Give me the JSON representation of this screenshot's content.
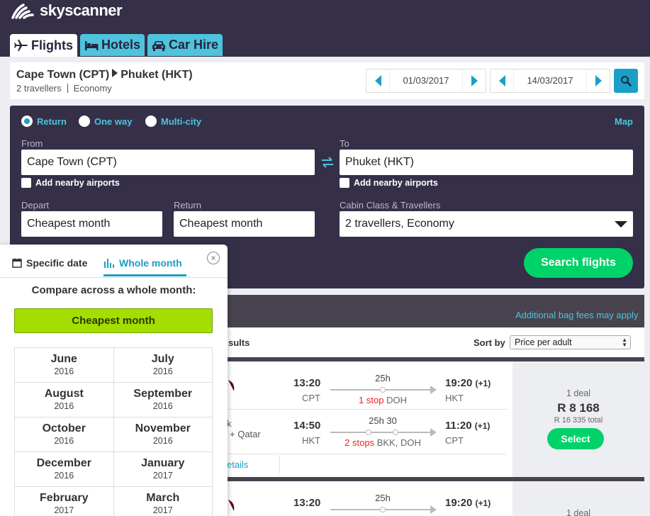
{
  "brand": {
    "name": "skyscanner"
  },
  "nav_tabs": [
    {
      "label": "Flights",
      "icon": "plane-icon",
      "active": true
    },
    {
      "label": "Hotels",
      "icon": "bed-icon",
      "active": false
    },
    {
      "label": "Car Hire",
      "icon": "car-icon",
      "active": false
    }
  ],
  "summary": {
    "origin": "Cape Town (CPT)",
    "destination": "Phuket (HKT)",
    "travellers": "2 travellers",
    "cabin": "Economy",
    "depart_date": "01/03/2017",
    "return_date": "14/03/2017"
  },
  "search_form": {
    "trip_types": [
      {
        "label": "Return",
        "selected": true
      },
      {
        "label": "One way",
        "selected": false
      },
      {
        "label": "Multi-city",
        "selected": false
      }
    ],
    "map_link": "Map",
    "from_label": "From",
    "from_value": "Cape Town (CPT)",
    "to_label": "To",
    "to_value": "Phuket (HKT)",
    "nearby_from": "Add nearby airports",
    "nearby_to": "Add nearby airports",
    "depart_label": "Depart",
    "depart_value": "Cheapest month",
    "return_label": "Return",
    "return_value": "Cheapest month",
    "cabin_label": "Cabin Class & Travellers",
    "cabin_value": "2 travellers, Economy",
    "search_button": "Search flights"
  },
  "results": {
    "bag_fees": "Additional bag fees may apply",
    "results_partial": "sults",
    "sort_label": "Sort by",
    "sort_value": "Price per adult",
    "card1": {
      "outbound": {
        "dep_time": "13:20",
        "dep_code": "CPT",
        "duration": "25h",
        "stops_count": "1 stop",
        "stops_via": "DOH",
        "arr_time": "19:20",
        "arr_plus": "(+1)",
        "arr_code": "HKT"
      },
      "inbound": {
        "dep_time": "14:50",
        "dep_code": "HKT",
        "duration": "25h 30",
        "stops_count": "2 stops",
        "stops_via": "BKK, DOH",
        "arr_time": "11:20",
        "arr_plus": "(+1)",
        "arr_code": "CPT"
      },
      "airline_fragment_1": "k",
      "airline_fragment_2": "+ Qatar",
      "details_fragment": "etails",
      "deals": "1 deal",
      "price": "R 8 168",
      "total": "R 16 335 total",
      "select": "Select"
    },
    "card2": {
      "dep_time": "13:20",
      "duration": "25h",
      "arr_time": "19:20",
      "arr_plus": "(+1)",
      "deals": "1 deal"
    }
  },
  "month_picker": {
    "tab_specific": "Specific date",
    "tab_whole": "Whole month",
    "heading": "Compare across a whole month:",
    "cheapest_button": "Cheapest month",
    "months": [
      {
        "month": "June",
        "year": "2016"
      },
      {
        "month": "July",
        "year": "2016"
      },
      {
        "month": "August",
        "year": "2016"
      },
      {
        "month": "September",
        "year": "2016"
      },
      {
        "month": "October",
        "year": "2016"
      },
      {
        "month": "November",
        "year": "2016"
      },
      {
        "month": "December",
        "year": "2016"
      },
      {
        "month": "January",
        "year": "2017"
      },
      {
        "month": "February",
        "year": "2017"
      },
      {
        "month": "March",
        "year": "2017"
      }
    ]
  },
  "colors": {
    "header_bg": "#352f48",
    "accent": "#1aa0c8",
    "tab_inactive": "#4ec3dc",
    "cta_green": "#00d26a",
    "cheapest_green": "#a4dd00",
    "stops_red": "#e22222"
  }
}
